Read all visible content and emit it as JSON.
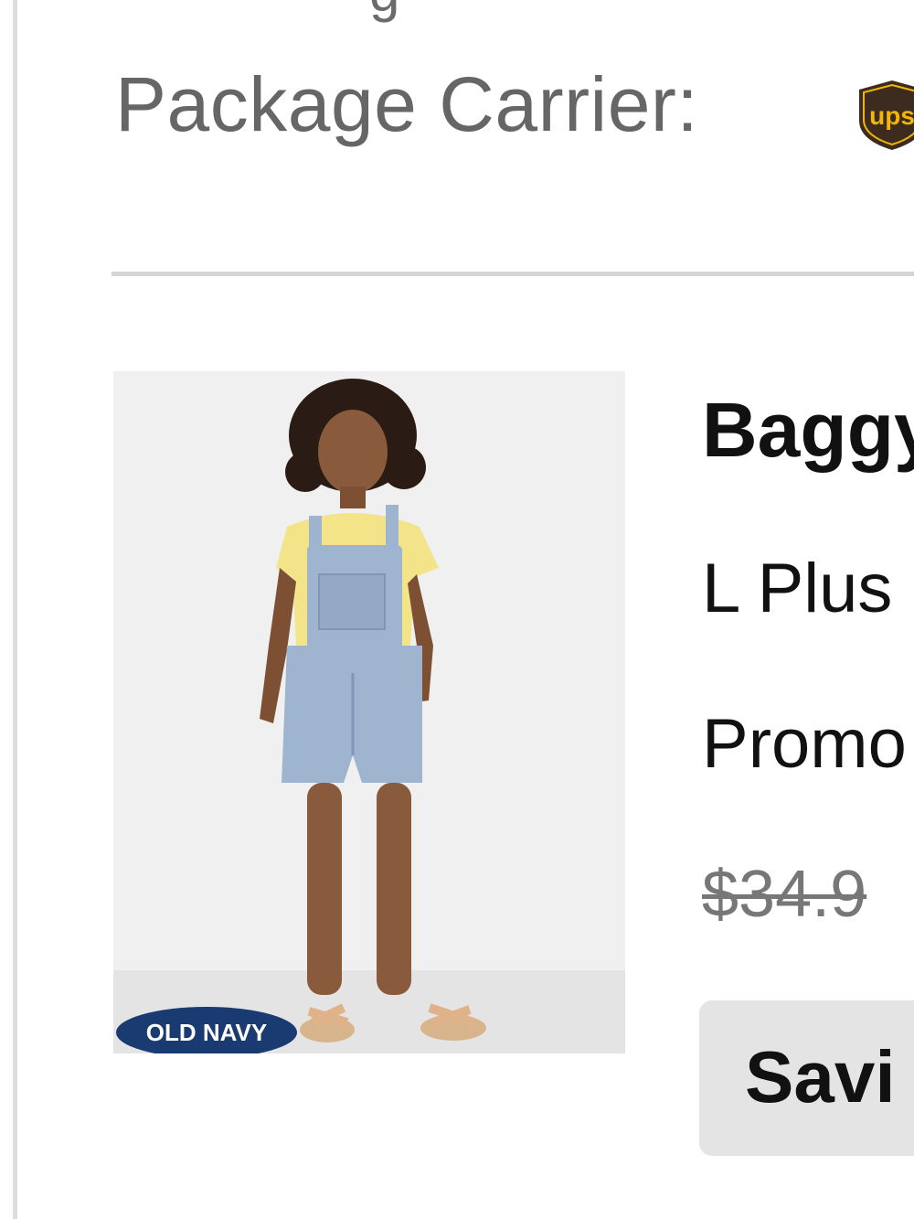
{
  "shipment": {
    "carrier_label": "Package Carrier:",
    "carrier_logo_icon": "ups-logo-icon",
    "carrier_logo_text": "ups"
  },
  "item": {
    "brand_badge_text": "OLD NAVY",
    "name": "Baggy",
    "size": "L Plus",
    "promo": "Promo",
    "original_price": "$34.9",
    "savings_label": "Savi"
  },
  "colors": {
    "label_gray": "#666666",
    "divider": "#d4d4d4",
    "ups_brown": "#3d2b1f",
    "ups_gold": "#f2b705",
    "brand_navy": "#1a3a72",
    "chip_bg": "#e4e4e4"
  }
}
